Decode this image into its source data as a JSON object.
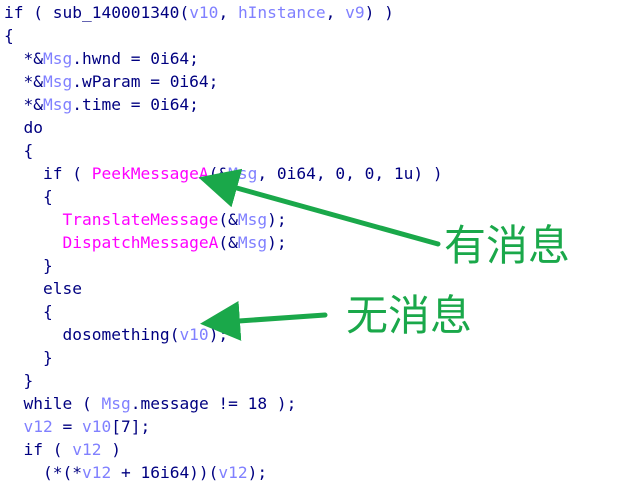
{
  "code_lines": [
    [
      {
        "t": "if ( ",
        "c": "kw"
      },
      {
        "t": "sub_140001340",
        "c": "fn"
      },
      {
        "t": "(",
        "c": "op"
      },
      {
        "t": "v10",
        "c": "var"
      },
      {
        "t": ", ",
        "c": "op"
      },
      {
        "t": "hInstance",
        "c": "var"
      },
      {
        "t": ", ",
        "c": "op"
      },
      {
        "t": "v9",
        "c": "var"
      },
      {
        "t": ") )",
        "c": "op"
      }
    ],
    [
      {
        "t": "{",
        "c": "op"
      }
    ],
    [
      {
        "t": "  *&",
        "c": "op"
      },
      {
        "t": "Msg",
        "c": "var"
      },
      {
        "t": ".hwnd = 0i64;",
        "c": "op"
      }
    ],
    [
      {
        "t": "  *&",
        "c": "op"
      },
      {
        "t": "Msg",
        "c": "var"
      },
      {
        "t": ".wParam = 0i64;",
        "c": "op"
      }
    ],
    [
      {
        "t": "  *&",
        "c": "op"
      },
      {
        "t": "Msg",
        "c": "var"
      },
      {
        "t": ".time = 0i64;",
        "c": "op"
      }
    ],
    [
      {
        "t": "  do",
        "c": "kw"
      }
    ],
    [
      {
        "t": "  {",
        "c": "op"
      }
    ],
    [
      {
        "t": "    if ( ",
        "c": "kw"
      },
      {
        "t": "PeekMessageA",
        "c": "api"
      },
      {
        "t": "(&",
        "c": "op"
      },
      {
        "t": "Msg",
        "c": "var"
      },
      {
        "t": ", 0i64, 0, 0, 1u) )",
        "c": "op"
      }
    ],
    [
      {
        "t": "    {",
        "c": "op"
      }
    ],
    [
      {
        "t": "      ",
        "c": "op"
      },
      {
        "t": "TranslateMessage",
        "c": "api"
      },
      {
        "t": "(&",
        "c": "op"
      },
      {
        "t": "Msg",
        "c": "var"
      },
      {
        "t": ");",
        "c": "op"
      }
    ],
    [
      {
        "t": "      ",
        "c": "op"
      },
      {
        "t": "DispatchMessageA",
        "c": "api"
      },
      {
        "t": "(&",
        "c": "op"
      },
      {
        "t": "Msg",
        "c": "var"
      },
      {
        "t": ");",
        "c": "op"
      }
    ],
    [
      {
        "t": "    }",
        "c": "op"
      }
    ],
    [
      {
        "t": "    else",
        "c": "kw"
      }
    ],
    [
      {
        "t": "    {",
        "c": "op"
      }
    ],
    [
      {
        "t": "      dosomething",
        "c": "fn"
      },
      {
        "t": "(",
        "c": "op"
      },
      {
        "t": "v10",
        "c": "var"
      },
      {
        "t": ");",
        "c": "op"
      }
    ],
    [
      {
        "t": "    }",
        "c": "op"
      }
    ],
    [
      {
        "t": "  }",
        "c": "op"
      }
    ],
    [
      {
        "t": "  while ( ",
        "c": "kw"
      },
      {
        "t": "Msg",
        "c": "var"
      },
      {
        "t": ".message != 18 );",
        "c": "op"
      }
    ],
    [
      {
        "t": "  ",
        "c": "op"
      },
      {
        "t": "v12",
        "c": "var"
      },
      {
        "t": " = ",
        "c": "op"
      },
      {
        "t": "v10",
        "c": "var"
      },
      {
        "t": "[7];",
        "c": "op"
      }
    ],
    [
      {
        "t": "  if ( ",
        "c": "kw"
      },
      {
        "t": "v12",
        "c": "var"
      },
      {
        "t": " )",
        "c": "op"
      }
    ],
    [
      {
        "t": "    (*(*",
        "c": "op"
      },
      {
        "t": "v12",
        "c": "var"
      },
      {
        "t": " + 16i64))(",
        "c": "op"
      },
      {
        "t": "v12",
        "c": "var"
      },
      {
        "t": ");",
        "c": "op"
      }
    ]
  ],
  "annotations": {
    "has_message": "有消息",
    "no_message": "无消息"
  },
  "colors": {
    "keyword": "#000080",
    "variable": "#8080ff",
    "api_call": "#ff00ff",
    "annotation": "#1aa84a",
    "background": "#ffffff"
  }
}
